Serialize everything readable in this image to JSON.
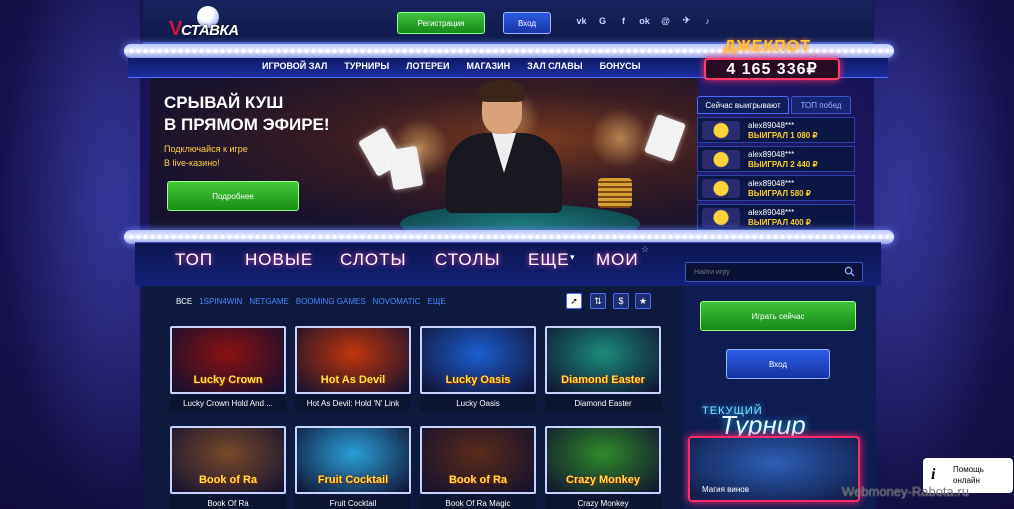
{
  "header": {
    "logo_text": "СТАВКА",
    "register_label": "Регистрация",
    "login_label": "Вход",
    "socials": [
      "vk-icon",
      "google-icon",
      "facebook-icon",
      "odnoklassniki-icon",
      "mail-icon",
      "telegram-icon",
      "tiktok-icon"
    ]
  },
  "nav": [
    "ИГРОВОЙ ЗАЛ",
    "ТУРНИРЫ",
    "ЛОТЕРЕИ",
    "МАГАЗИН",
    "ЗАЛ СЛАВЫ",
    "БОНУСЫ"
  ],
  "banner": {
    "title_line1": "СРЫВАЙ КУШ",
    "title_line2": "В ПРЯМОМ ЭФИРЕ!",
    "subtitle_line1": "Подключайся к игре",
    "subtitle_line2": "В live-казино!",
    "button_label": "Подробнее"
  },
  "jackpot": {
    "title": "ДЖЕКПОТ",
    "value": "4 165 336₽"
  },
  "winners": {
    "tab_now": "Сейчас выигрывают",
    "tab_top": "ТОП побед",
    "rows": [
      {
        "user": "alex89048***",
        "win": "ВЫИГРАЛ 1 080 ₽"
      },
      {
        "user": "alex89048***",
        "win": "ВЫИГРАЛ 2 440 ₽"
      },
      {
        "user": "alex89048***",
        "win": "ВЫИГРАЛ 580 ₽"
      },
      {
        "user": "alex89048***",
        "win": "ВЫИГРАЛ 400 ₽"
      }
    ]
  },
  "categories": [
    "ТОП",
    "НОВЫЕ",
    "СЛОТЫ",
    "СТОЛЫ",
    "ЕЩЕ",
    "МОИ"
  ],
  "search": {
    "placeholder": "Найти игру"
  },
  "providers": [
    "ВСЕ",
    "1SPIN4WIN",
    "NETGAME",
    "BOOMING GAMES",
    "NOVOMATIC",
    "ЕЩЕ"
  ],
  "tools": [
    "cursor-icon",
    "sort-icon",
    "dollar-icon",
    "star-icon"
  ],
  "games": [
    {
      "name": "Lucky Crown Hold And ...",
      "art": "Lucky Crown",
      "color": "#8a1010"
    },
    {
      "name": "Hot As Devil: Hold 'N' Link",
      "art": "Hot As Devil",
      "color": "#c2360c"
    },
    {
      "name": "Lucky Oasis",
      "art": "Lucky Oasis",
      "color": "#1d5fd1"
    },
    {
      "name": "Diamond Easter",
      "art": "Diamond Easter",
      "color": "#1b8a7a"
    },
    {
      "name": "Book Of Ra",
      "art": "Book of Ra",
      "color": "#7a4a2a"
    },
    {
      "name": "Fruit Cocktail",
      "art": "Fruit Cocktail",
      "color": "#2aa0d8"
    },
    {
      "name": "Book Of Ra Magic",
      "art": "Book of Ra",
      "color": "#5a2a18"
    },
    {
      "name": "Crazy Monkey",
      "art": "Crazy Monkey",
      "color": "#2f8a2a"
    }
  ],
  "side": {
    "play_label": "Играть сейчас",
    "login_label": "Вход",
    "tournament_line1": "ТЕКУЩИЙ",
    "tournament_line2": "Турнир",
    "tournament_caption": "Магия винов"
  },
  "help": {
    "line1": "Помощь",
    "line2": "онлайн"
  },
  "watermark": "Webmoney-Rabota.ru"
}
